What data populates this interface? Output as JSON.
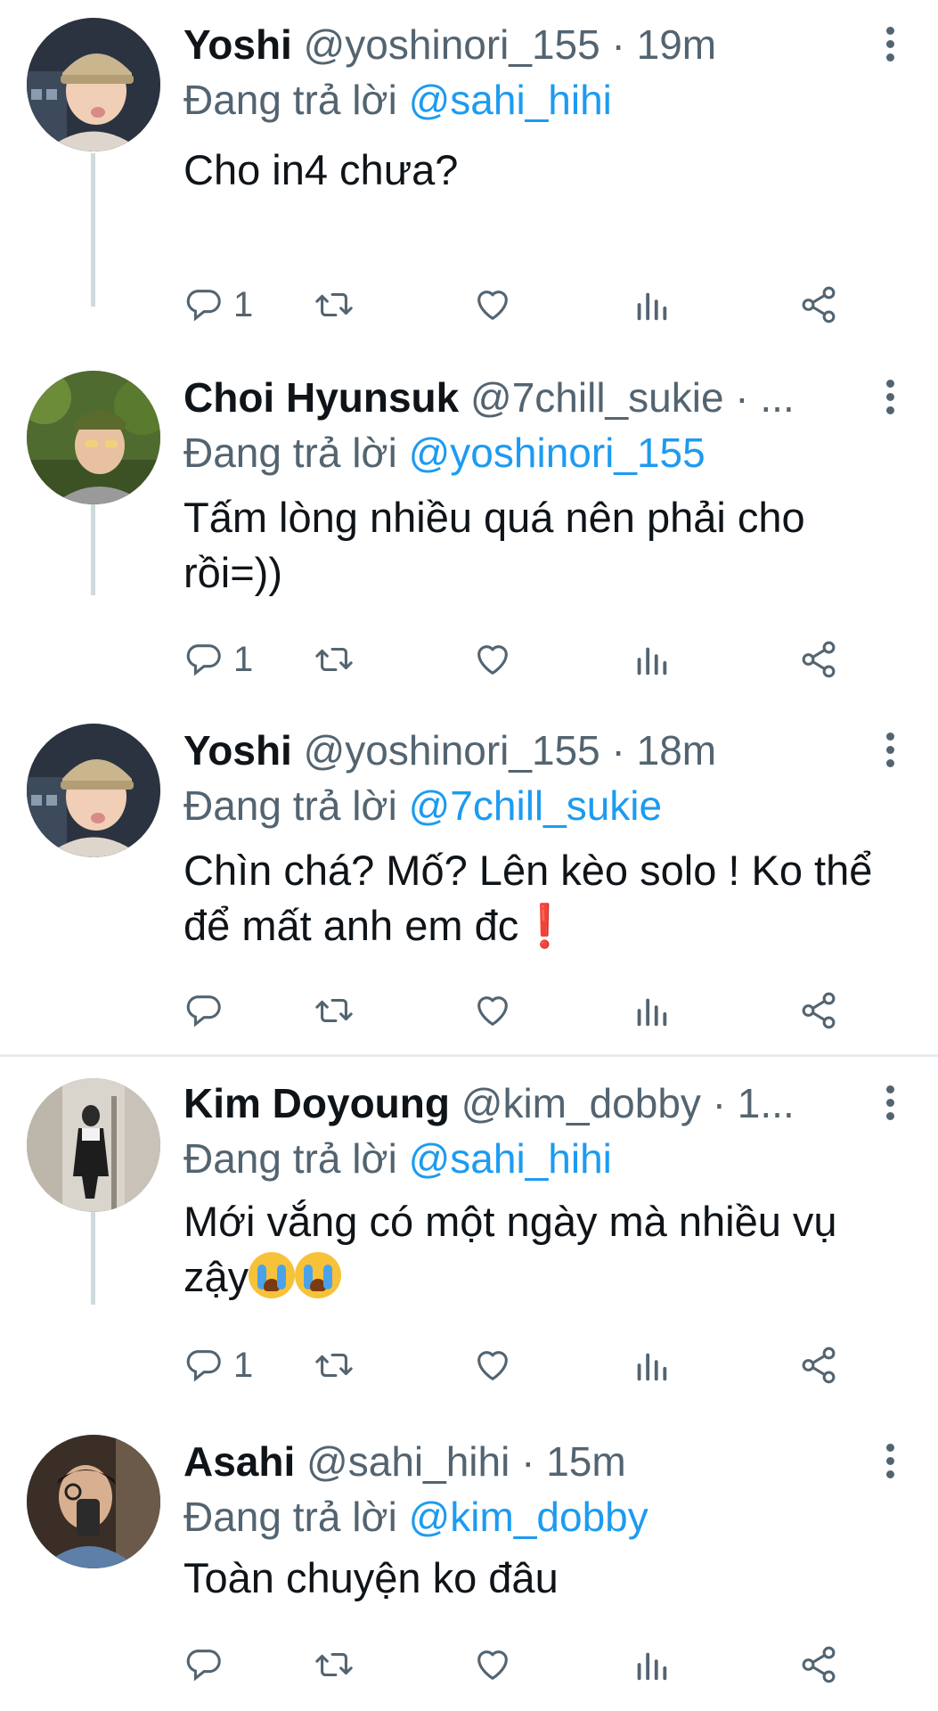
{
  "colors": {
    "link": "#1d9bf0",
    "secondary_text": "#536471",
    "thread_line": "#cfd9de"
  },
  "tweets": [
    {
      "name": "Yoshi",
      "handle": "@yoshinori_155 · 19m",
      "replying_prefix": "Đang trả lời",
      "replying_to": "@sahi_hihi",
      "text": "Cho in4 chưa?",
      "reply_count": "1",
      "avatar": "yoshi-avatar"
    },
    {
      "name": "Choi Hyunsuk",
      "handle": "@7chill_sukie · ...",
      "replying_prefix": "Đang trả lời",
      "replying_to": "@yoshinori_155",
      "text": "Tấm lòng nhiều quá nên phải cho rồi=))",
      "reply_count": "1",
      "avatar": "hyunsuk-avatar"
    },
    {
      "name": "Yoshi",
      "handle": "@yoshinori_155 · 18m",
      "replying_prefix": "Đang trả lời",
      "replying_to": "@7chill_sukie",
      "text": "Chìn chá? Mố? Lên kèo solo ! Ko thể để mất anh em đc",
      "text_emoji": "❗",
      "reply_count": "",
      "avatar": "yoshi-avatar"
    },
    {
      "name": "Kim Doyoung",
      "handle": "@kim_dobby · 1...",
      "replying_prefix": "Đang trả lời",
      "replying_to": "@sahi_hihi",
      "text": "Mới vắng có một ngày mà nhiều vụ zậy",
      "text_emoji": "😭😭",
      "reply_count": "1",
      "avatar": "doyoung-avatar"
    },
    {
      "name": "Asahi",
      "handle": "@sahi_hihi · 15m",
      "replying_prefix": "Đang trả lời",
      "replying_to": "@kim_dobby",
      "text": "Toàn chuyện ko đâu",
      "reply_count": "",
      "avatar": "asahi-avatar"
    }
  ],
  "icons": {
    "reply": "reply-icon",
    "retweet": "retweet-icon",
    "like": "heart-icon",
    "analytics": "analytics-icon",
    "share": "share-icon",
    "more": "more-icon"
  }
}
